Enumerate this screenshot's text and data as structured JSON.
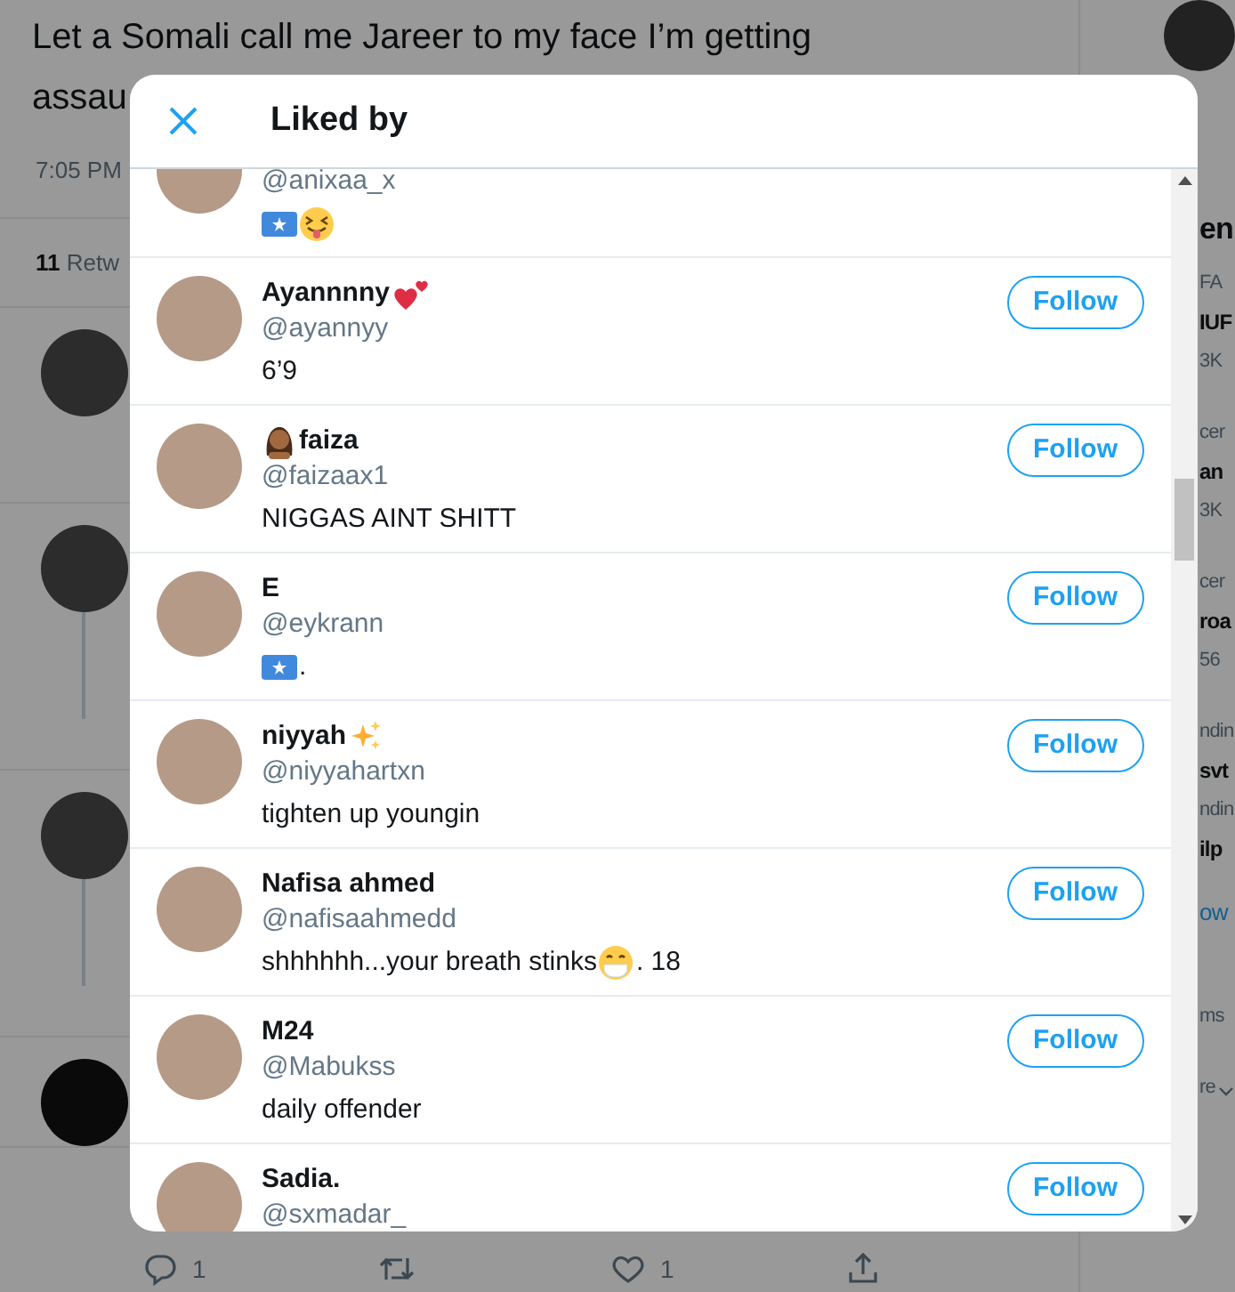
{
  "page": {
    "tweet_lines": [
      "Let a Somali call me Jareer to my face I’m getting",
      "assau"
    ],
    "time": "7:05 PM",
    "stats": {
      "count": "11",
      "label": "Retw"
    },
    "actions": [
      {
        "kind": "reply",
        "count": "1"
      },
      {
        "kind": "retweet"
      },
      {
        "kind": "like",
        "count": "1"
      },
      {
        "kind": "share"
      }
    ],
    "sidebar_fragments": [
      {
        "kind": "heading",
        "text": "en"
      },
      {
        "kind": "small",
        "text": "FA"
      },
      {
        "kind": "bold",
        "text": "IUF"
      },
      {
        "kind": "small",
        "text": "3K"
      },
      {
        "kind": "small",
        "text": "cer"
      },
      {
        "kind": "bold",
        "text": "an"
      },
      {
        "kind": "small",
        "text": "3K"
      },
      {
        "kind": "small",
        "text": "cer"
      },
      {
        "kind": "bold",
        "text": "roa"
      },
      {
        "kind": "small",
        "text": "56"
      },
      {
        "kind": "small",
        "text": "ndin"
      },
      {
        "kind": "bold",
        "text": "svt"
      },
      {
        "kind": "small",
        "text": "ndin"
      },
      {
        "kind": "bold",
        "text": "ilp"
      },
      {
        "kind": "link",
        "text": "ow"
      },
      {
        "kind": "small",
        "text": "ms"
      },
      {
        "kind": "more",
        "text": "re"
      }
    ]
  },
  "modal": {
    "title": "Liked by",
    "users": [
      {
        "handle": "@anixaa_x",
        "bio_parts": [
          {
            "kind": "flag"
          },
          {
            "kind": "tongue"
          }
        ]
      },
      {
        "name_parts": [
          {
            "kind": "text",
            "text": "Ayannnny"
          },
          {
            "kind": "hearts"
          }
        ],
        "handle": "@ayannyy",
        "bio_parts": [
          {
            "kind": "text",
            "text": "6’9"
          }
        ],
        "follow": "Follow"
      },
      {
        "name_parts": [
          {
            "kind": "woman"
          },
          {
            "kind": "text",
            "text": "faiza"
          }
        ],
        "handle": "@faizaax1",
        "bio_parts": [
          {
            "kind": "text",
            "text": "NIGGAS AINT SHITT"
          }
        ],
        "follow": "Follow"
      },
      {
        "name_parts": [
          {
            "kind": "text",
            "text": "E"
          }
        ],
        "handle": "@eykrann",
        "bio_parts": [
          {
            "kind": "flag"
          },
          {
            "kind": "text",
            "text": "."
          }
        ],
        "follow": "Follow"
      },
      {
        "name_parts": [
          {
            "kind": "text",
            "text": "niyyah"
          },
          {
            "kind": "sparkles"
          }
        ],
        "handle": "@niyyahartxn",
        "bio_parts": [
          {
            "kind": "text",
            "text": "tighten up youngin"
          }
        ],
        "follow": "Follow"
      },
      {
        "name_parts": [
          {
            "kind": "text",
            "text": "Nafisa ahmed"
          }
        ],
        "handle": "@nafisaahmedd",
        "bio_parts": [
          {
            "kind": "text",
            "text": "shhhhhh...your breath stinks"
          },
          {
            "kind": "mask"
          },
          {
            "kind": "text",
            "text": ". 18"
          }
        ],
        "follow": "Follow"
      },
      {
        "name_parts": [
          {
            "kind": "text",
            "text": "M24"
          }
        ],
        "handle": "@Mabukss",
        "bio_parts": [
          {
            "kind": "text",
            "text": "daily offender"
          }
        ],
        "follow": "Follow"
      },
      {
        "name_parts": [
          {
            "kind": "text",
            "text": "Sadia."
          }
        ],
        "handle": "@sxmadar_",
        "follow": "Follow"
      }
    ]
  }
}
